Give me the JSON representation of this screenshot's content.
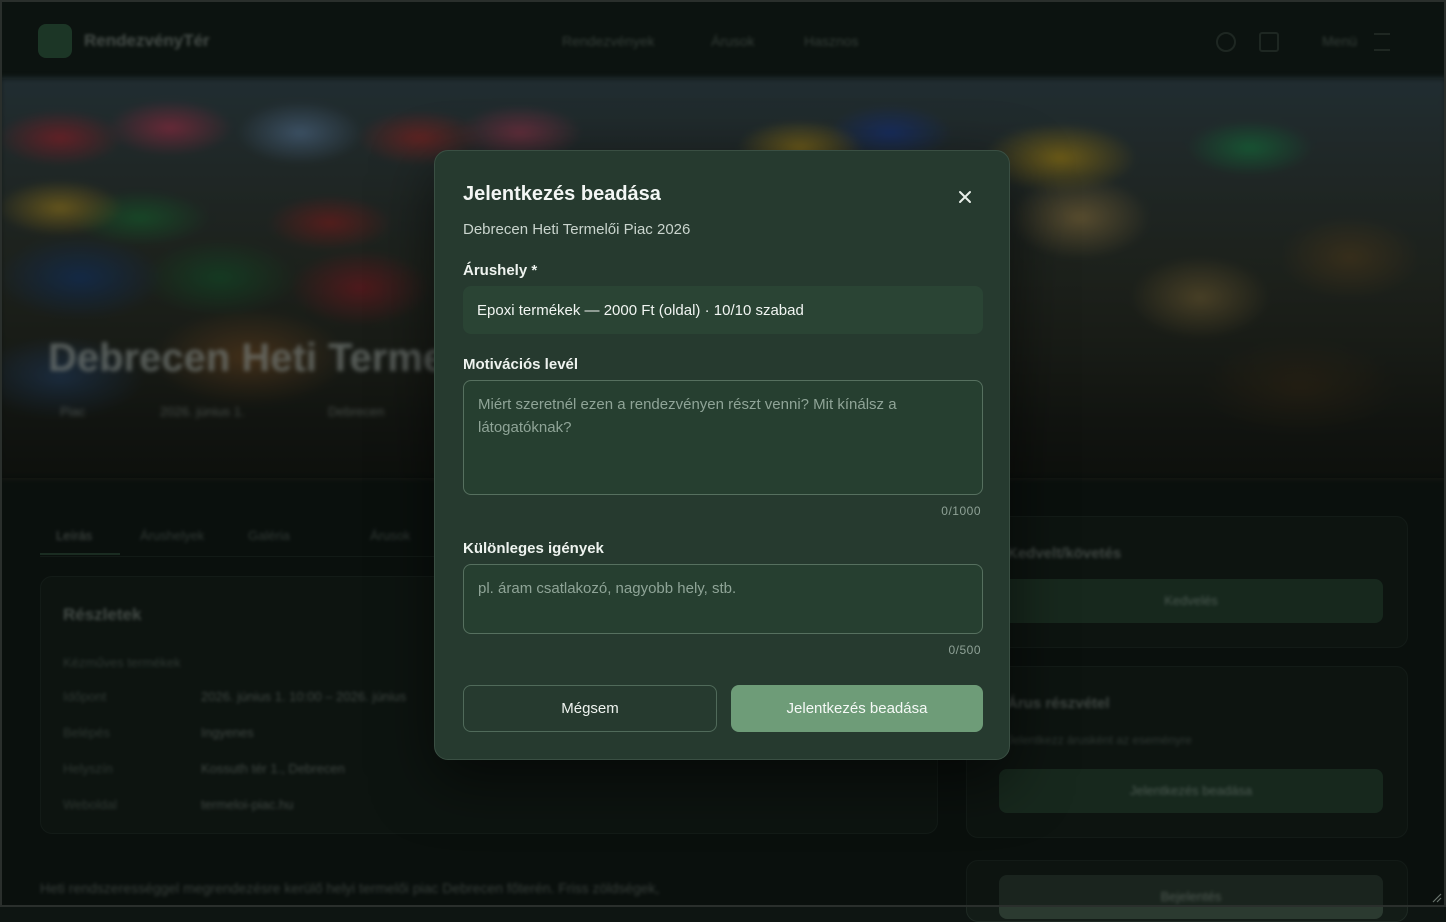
{
  "app": {
    "brand": "RendezvényTér",
    "nav": [
      "Rendezvények",
      "Árusok",
      "Hasznos"
    ],
    "menu_label": "Menü"
  },
  "hero": {
    "title": "Debrecen Heti Termelői Piac 2026",
    "meta": [
      "Piac",
      "2026. június 1.",
      "Debrecen"
    ]
  },
  "tabs": [
    "Leírás",
    "Árushelyek",
    "Galéria",
    "Árusok"
  ],
  "details": {
    "title": "Részletek",
    "rows": [
      {
        "label": "Kategória",
        "value": "Kézműves termékek"
      },
      {
        "label": "Időpont",
        "value": "2026. június 1. 10:00 – 2026. június"
      },
      {
        "label": "Belépés",
        "value": "Ingyenes"
      },
      {
        "label": "Helyszín",
        "value": "Kossuth tér 1., Debrecen"
      },
      {
        "label": "Weboldal",
        "value": "termeloi-piac.hu"
      }
    ]
  },
  "description": "Heti rendszerességgel megrendezésre kerülő helyi termelői piac Debrecen főterén. Friss zöldségek,",
  "sidebar": {
    "card1": {
      "title": "Kedvelt/követés",
      "button": "Kedvelés"
    },
    "card2": {
      "title": "Árus részvétel",
      "subtitle": "Jelentkezz árusként az eseményre",
      "button": "Jelentkezés beadása"
    },
    "card3": {
      "button": "Bejelentés"
    }
  },
  "modal": {
    "title": "Jelentkezés beadása",
    "subtitle": "Debrecen Heti Termelői Piac 2026",
    "stall_label": "Árushely *",
    "stall_value": "Epoxi termékek — 2000 Ft (oldal) · 10/10 szabad",
    "motivation_label": "Motivációs levél",
    "motivation_placeholder": "Miért szeretnél ezen a rendezvényen részt venni? Mit kínálsz a látogatóknak?",
    "motivation_counter": "0/1000",
    "special_label": "Különleges igények",
    "special_placeholder": "pl. áram csatlakozó, nagyobb hely, stb.",
    "special_counter": "0/500",
    "cancel_label": "Mégsem",
    "submit_label": "Jelentkezés beadása"
  },
  "colors": {
    "modal_bg": "#263a2f",
    "accent": "#6e9c78",
    "page_bg": "#0e1512"
  }
}
